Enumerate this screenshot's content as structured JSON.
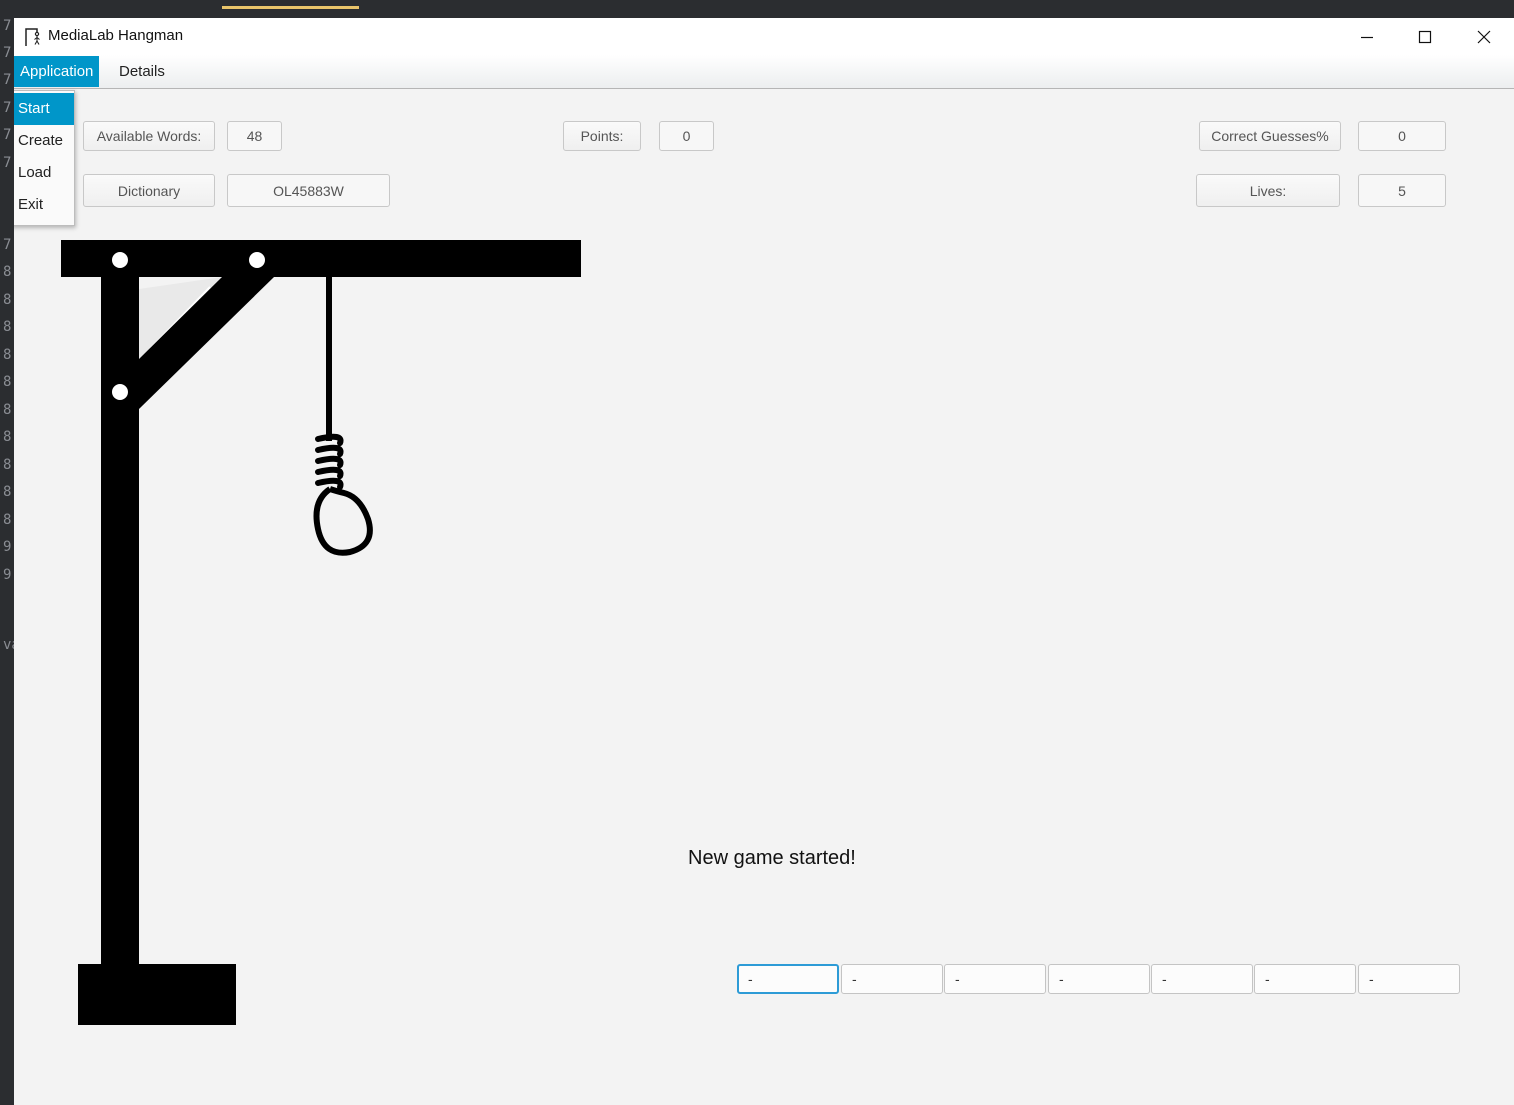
{
  "window": {
    "title": "MediaLab Hangman"
  },
  "menubar": {
    "menus": [
      {
        "label": "Application"
      },
      {
        "label": "Details"
      }
    ]
  },
  "application_menu": {
    "items": [
      {
        "label": "Start"
      },
      {
        "label": "Create"
      },
      {
        "label": "Load"
      },
      {
        "label": "Exit"
      }
    ]
  },
  "stats": {
    "available_words_label": "Available Words:",
    "available_words_value": "48",
    "points_label": "Points:",
    "points_value": "0",
    "correct_guesses_label": "Correct Guesses%",
    "correct_guesses_value": "0",
    "dictionary_label": "Dictionary",
    "dictionary_value": "OL45883W",
    "lives_label": "Lives:",
    "lives_value": "5"
  },
  "game": {
    "message": "New game started!",
    "word_slots": [
      "-",
      "-",
      "-",
      "-",
      "-",
      "-",
      "-"
    ]
  },
  "ide_background": {
    "gutter_numbers": [
      "7",
      "7",
      "7",
      "7",
      "7",
      "7",
      "7",
      "8",
      "8",
      "8",
      "8",
      "8",
      "8",
      "8",
      "8",
      "8",
      "8",
      "9",
      "9"
    ],
    "gutter_fragment": "va"
  },
  "colors": {
    "accent": "#0096c9",
    "window_bg": "#f3f3f3",
    "focus_border": "#2d9bd6"
  },
  "icons": {
    "app_icon": "hangman-icon",
    "minimize": "minimize-icon",
    "maximize": "maximize-icon",
    "close": "close-icon"
  }
}
